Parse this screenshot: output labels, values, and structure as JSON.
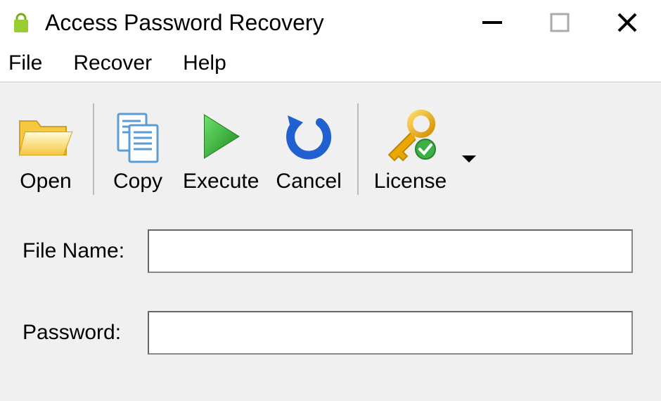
{
  "titlebar": {
    "title": "Access Password Recovery"
  },
  "menubar": {
    "file": "File",
    "recover": "Recover",
    "help": "Help"
  },
  "toolbar": {
    "open": "Open",
    "copy": "Copy",
    "execute": "Execute",
    "cancel": "Cancel",
    "license": "License"
  },
  "form": {
    "filename_label": "File Name:",
    "filename_value": "",
    "password_label": "Password:",
    "password_value": ""
  }
}
